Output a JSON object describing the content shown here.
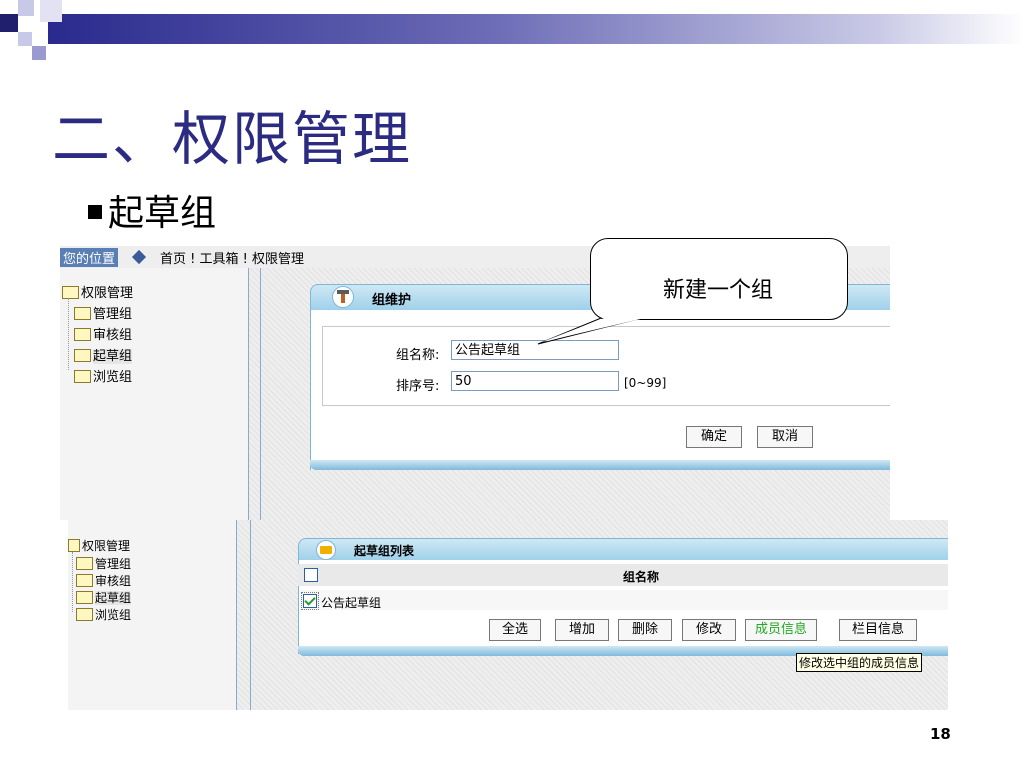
{
  "slide": {
    "title": "二、权限管理",
    "bullet": "起草组",
    "page_number": "18",
    "callout": "新建一个组",
    "accent_color": "#2b2b82"
  },
  "top_screen": {
    "breadcrumb_label": "您的位置",
    "breadcrumb_path": "首页 ! 工具箱 ! 权限管理",
    "tree": {
      "root": "权限管理",
      "items": [
        "管理组",
        "审核组",
        "起草组",
        "浏览组"
      ]
    },
    "panel_title": "组维护",
    "name_label": "组名称:",
    "name_value": "公告起草组",
    "order_label": "排序号:",
    "order_value": "50",
    "order_hint": "[0~99]",
    "confirm_button": "确定",
    "cancel_button": "取消"
  },
  "bottom_screen": {
    "tree": {
      "root": "权限管理",
      "items": [
        "管理组",
        "审核组",
        "起草组",
        "浏览组"
      ]
    },
    "panel_title": "起草组列表",
    "column_header": "组名称",
    "rows": [
      "公告起草组"
    ],
    "buttons": {
      "select_all": "全选",
      "add": "增加",
      "delete": "删除",
      "edit": "修改",
      "members": "成员信息",
      "columns": "栏目信息"
    },
    "tooltip": "修改选中组的成员信息",
    "members_color": "#22aa22"
  }
}
